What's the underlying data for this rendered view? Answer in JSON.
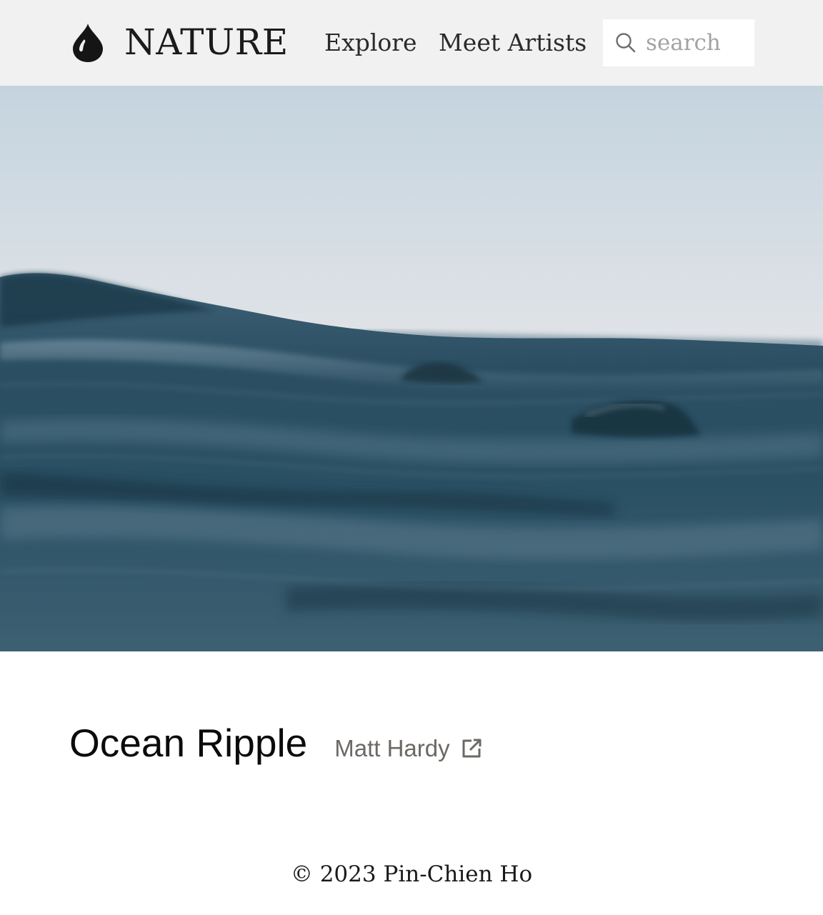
{
  "header": {
    "logo_icon": "water-drop-icon",
    "brand": "NATURE",
    "nav": {
      "explore": "Explore",
      "meet_artists": "Meet Artists"
    },
    "search": {
      "icon": "search-icon",
      "placeholder": "search",
      "value": ""
    }
  },
  "hero": {
    "subject": "ocean-waves-photo"
  },
  "photo": {
    "title": "Ocean Ripple",
    "photographer": "Matt Hardy",
    "external_icon": "external-link-icon"
  },
  "footer": {
    "copyright": "© 2023 Pin-Chien Ho"
  },
  "colors": {
    "header_bg": "#f1f1f1",
    "text_dark": "#111111",
    "muted_text": "#6c6864",
    "ocean_dark": "#1f3f52",
    "sky_light": "#c9d8e3",
    "sky_pink": "#f1d8d0"
  }
}
